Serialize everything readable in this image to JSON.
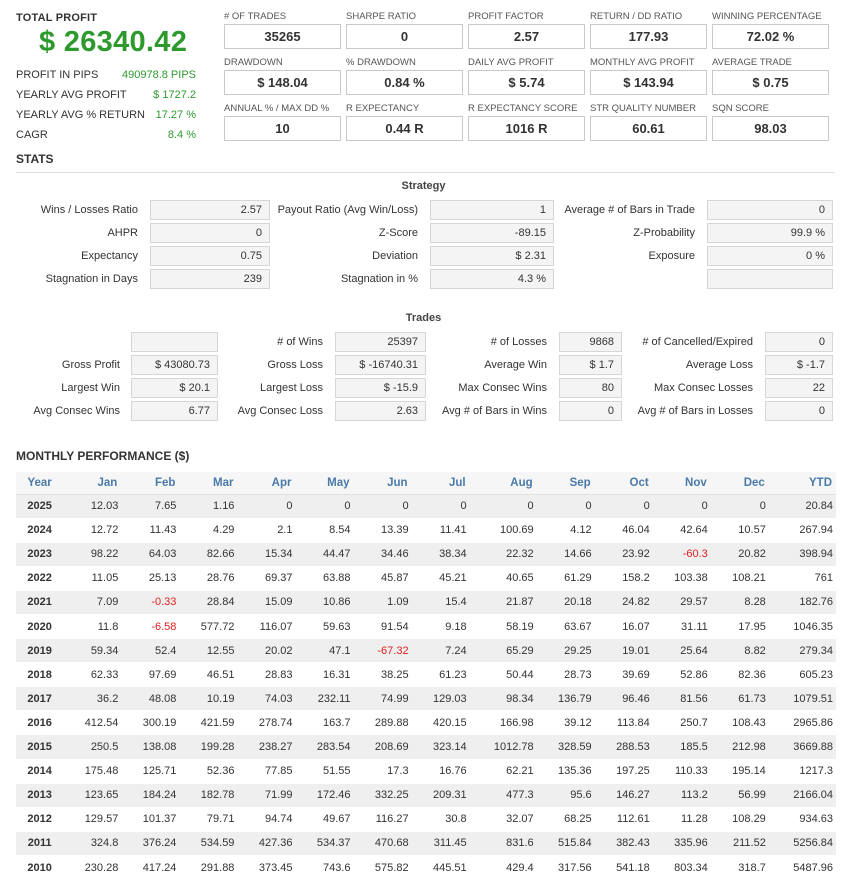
{
  "summary": {
    "total_profit_label": "TOTAL PROFIT",
    "total_profit_value": "$ 26340.42",
    "rows": [
      {
        "label": "PROFIT IN PIPS",
        "value": "490978.8 PIPS"
      },
      {
        "label": "YEARLY AVG PROFIT",
        "value": "$ 1727.2"
      },
      {
        "label": "YEARLY AVG % RETURN",
        "value": "17.27 %"
      },
      {
        "label": "CAGR",
        "value": "8.4 %"
      }
    ]
  },
  "metrics": [
    {
      "label": "# OF TRADES",
      "value": "35265"
    },
    {
      "label": "SHARPE RATIO",
      "value": "0"
    },
    {
      "label": "PROFIT FACTOR",
      "value": "2.57"
    },
    {
      "label": "RETURN / DD RATIO",
      "value": "177.93"
    },
    {
      "label": "WINNING PERCENTAGE",
      "value": "72.02 %"
    },
    {
      "label": "DRAWDOWN",
      "value": "$ 148.04"
    },
    {
      "label": "% DRAWDOWN",
      "value": "0.84 %"
    },
    {
      "label": "DAILY AVG PROFIT",
      "value": "$ 5.74"
    },
    {
      "label": "MONTHLY AVG PROFIT",
      "value": "$ 143.94"
    },
    {
      "label": "AVERAGE TRADE",
      "value": "$ 0.75"
    },
    {
      "label": "ANNUAL % / MAX DD %",
      "value": "10"
    },
    {
      "label": "R EXPECTANCY",
      "value": "0.44 R"
    },
    {
      "label": "R EXPECTANCY SCORE",
      "value": "1016 R"
    },
    {
      "label": "STR QUALITY NUMBER",
      "value": "60.61"
    },
    {
      "label": "SQN SCORE",
      "value": "98.03"
    }
  ],
  "stats_title": "STATS",
  "strategy": {
    "title": "Strategy",
    "rows": [
      [
        {
          "label": "Wins / Losses Ratio",
          "value": "2.57"
        },
        {
          "label": "Payout Ratio (Avg Win/Loss)",
          "value": "1"
        },
        {
          "label": "Average # of Bars in Trade",
          "value": "0"
        }
      ],
      [
        {
          "label": "AHPR",
          "value": "0"
        },
        {
          "label": "Z-Score",
          "value": "-89.15"
        },
        {
          "label": "Z-Probability",
          "value": "99.9 %"
        }
      ],
      [
        {
          "label": "Expectancy",
          "value": "0.75"
        },
        {
          "label": "Deviation",
          "value": "$ 2.31"
        },
        {
          "label": "Exposure",
          "value": "0 %"
        }
      ],
      [
        {
          "label": "Stagnation in Days",
          "value": "239"
        },
        {
          "label": "Stagnation in %",
          "value": "4.3 %"
        },
        {
          "label": "",
          "value": ""
        }
      ]
    ]
  },
  "trades": {
    "title": "Trades",
    "rows": [
      [
        {
          "label": "",
          "value": ""
        },
        {
          "label": "# of Wins",
          "value": "25397"
        },
        {
          "label": "# of Losses",
          "value": "9868"
        },
        {
          "label": "# of Cancelled/Expired",
          "value": "0"
        }
      ],
      [
        {
          "label": "Gross Profit",
          "value": "$ 43080.73"
        },
        {
          "label": "Gross Loss",
          "value": "$ -16740.31"
        },
        {
          "label": "Average Win",
          "value": "$ 1.7"
        },
        {
          "label": "Average Loss",
          "value": "$ -1.7"
        }
      ],
      [
        {
          "label": "Largest Win",
          "value": "$ 20.1"
        },
        {
          "label": "Largest Loss",
          "value": "$ -15.9"
        },
        {
          "label": "Max Consec Wins",
          "value": "80"
        },
        {
          "label": "Max Consec Losses",
          "value": "22"
        }
      ],
      [
        {
          "label": "Avg Consec Wins",
          "value": "6.77"
        },
        {
          "label": "Avg Consec Loss",
          "value": "2.63"
        },
        {
          "label": "Avg # of Bars in Wins",
          "value": "0"
        },
        {
          "label": "Avg # of Bars in Losses",
          "value": "0"
        }
      ]
    ]
  },
  "monthly": {
    "title": "MONTHLY PERFORMANCE ($)",
    "headers": [
      "Year",
      "Jan",
      "Feb",
      "Mar",
      "Apr",
      "May",
      "Jun",
      "Jul",
      "Aug",
      "Sep",
      "Oct",
      "Nov",
      "Dec",
      "YTD"
    ],
    "rows": [
      [
        "2025",
        "12.03",
        "7.65",
        "1.16",
        "0",
        "0",
        "0",
        "0",
        "0",
        "0",
        "0",
        "0",
        "0",
        "20.84"
      ],
      [
        "2024",
        "12.72",
        "11.43",
        "4.29",
        "2.1",
        "8.54",
        "13.39",
        "11.41",
        "100.69",
        "4.12",
        "46.04",
        "42.64",
        "10.57",
        "267.94"
      ],
      [
        "2023",
        "98.22",
        "64.03",
        "82.66",
        "15.34",
        "44.47",
        "34.46",
        "38.34",
        "22.32",
        "14.66",
        "23.92",
        "-60.3",
        "20.82",
        "398.94"
      ],
      [
        "2022",
        "11.05",
        "25.13",
        "28.76",
        "69.37",
        "63.88",
        "45.87",
        "45.21",
        "40.65",
        "61.29",
        "158.2",
        "103.38",
        "108.21",
        "761"
      ],
      [
        "2021",
        "7.09",
        "-0.33",
        "28.84",
        "15.09",
        "10.86",
        "1.09",
        "15.4",
        "21.87",
        "20.18",
        "24.82",
        "29.57",
        "8.28",
        "182.76"
      ],
      [
        "2020",
        "11.8",
        "-6.58",
        "577.72",
        "116.07",
        "59.63",
        "91.54",
        "9.18",
        "58.19",
        "63.67",
        "16.07",
        "31.11",
        "17.95",
        "1046.35"
      ],
      [
        "2019",
        "59.34",
        "52.4",
        "12.55",
        "20.02",
        "47.1",
        "-67.32",
        "7.24",
        "65.29",
        "29.25",
        "19.01",
        "25.64",
        "8.82",
        "279.34"
      ],
      [
        "2018",
        "62.33",
        "97.69",
        "46.51",
        "28.83",
        "16.31",
        "38.25",
        "61.23",
        "50.44",
        "28.73",
        "39.69",
        "52.86",
        "82.36",
        "605.23"
      ],
      [
        "2017",
        "36.2",
        "48.08",
        "10.19",
        "74.03",
        "232.11",
        "74.99",
        "129.03",
        "98.34",
        "136.79",
        "96.46",
        "81.56",
        "61.73",
        "1079.51"
      ],
      [
        "2016",
        "412.54",
        "300.19",
        "421.59",
        "278.74",
        "163.7",
        "289.88",
        "420.15",
        "166.98",
        "39.12",
        "113.84",
        "250.7",
        "108.43",
        "2965.86"
      ],
      [
        "2015",
        "250.5",
        "138.08",
        "199.28",
        "238.27",
        "283.54",
        "208.69",
        "323.14",
        "1012.78",
        "328.59",
        "288.53",
        "185.5",
        "212.98",
        "3669.88"
      ],
      [
        "2014",
        "175.48",
        "125.71",
        "52.36",
        "77.85",
        "51.55",
        "17.3",
        "16.76",
        "62.21",
        "135.36",
        "197.25",
        "110.33",
        "195.14",
        "1217.3"
      ],
      [
        "2013",
        "123.65",
        "184.24",
        "182.78",
        "71.99",
        "172.46",
        "332.25",
        "209.31",
        "477.3",
        "95.6",
        "146.27",
        "113.2",
        "56.99",
        "2166.04"
      ],
      [
        "2012",
        "129.57",
        "101.37",
        "79.71",
        "94.74",
        "49.67",
        "116.27",
        "30.8",
        "32.07",
        "68.25",
        "112.61",
        "11.28",
        "108.29",
        "934.63"
      ],
      [
        "2011",
        "324.8",
        "376.24",
        "534.59",
        "427.36",
        "534.37",
        "470.68",
        "311.45",
        "831.6",
        "515.84",
        "382.43",
        "335.96",
        "211.52",
        "5256.84"
      ],
      [
        "2010",
        "230.28",
        "417.24",
        "291.88",
        "373.45",
        "743.6",
        "575.82",
        "445.51",
        "429.4",
        "317.56",
        "541.18",
        "803.34",
        "318.7",
        "5487.96"
      ]
    ]
  }
}
